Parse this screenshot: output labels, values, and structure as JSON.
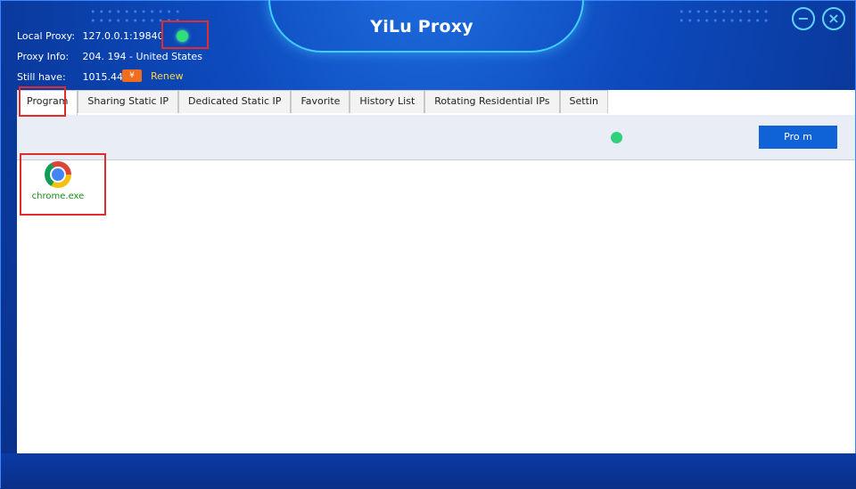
{
  "window": {
    "title": "YiLu Proxy"
  },
  "info": {
    "local_proxy_label": "Local Proxy:",
    "local_proxy_value": "127.0.0.1:19840",
    "proxy_info_label": "Proxy Info:",
    "proxy_info_value": "204.          194 - United States",
    "still_have_label": "Still have:",
    "still_have_value": "1015.44",
    "renew_icon_text": "¥",
    "renew_label": "Renew"
  },
  "tabs": [
    {
      "label": "Program"
    },
    {
      "label": "Sharing Static IP"
    },
    {
      "label": "Dedicated Static IP"
    },
    {
      "label": "Favorite"
    },
    {
      "label": "History List"
    },
    {
      "label": "Rotating Residential IPs"
    },
    {
      "label": "Settin"
    }
  ],
  "toolbar": {
    "program_button_label": "Pro   m"
  },
  "apps": [
    {
      "name": "chrome.exe"
    }
  ],
  "colors": {
    "accent": "#1063d6",
    "status_green": "#2fe07a",
    "highlight": "#e22c2c",
    "renew": "#ffd640"
  }
}
